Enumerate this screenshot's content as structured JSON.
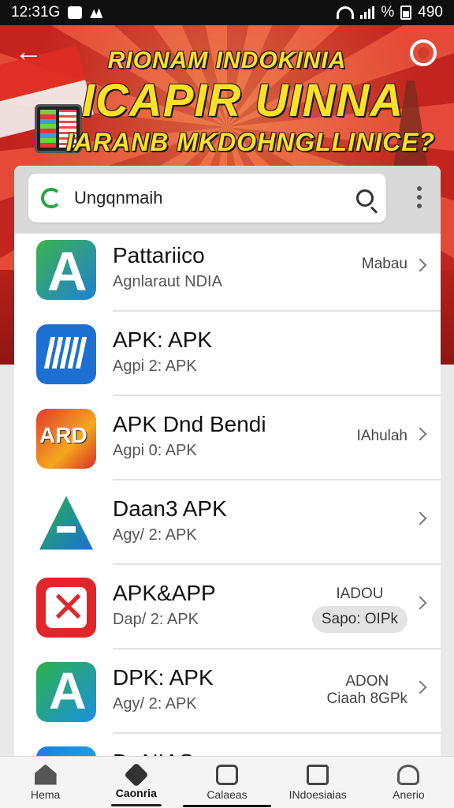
{
  "status_bar": {
    "time": "12:31G",
    "right_text": "%",
    "battery_text": "490"
  },
  "banner": {
    "line1": "RIONAM INDOKINIA",
    "line2": "ICAPIR UINNA",
    "line3": "IARANB MKDOHNGLLINICE?"
  },
  "search": {
    "value": "Ungqnmaih"
  },
  "apps": [
    {
      "title": "Pattariico",
      "subtitle": "Agnlaraut NDIA",
      "meta": "Mabau",
      "meta_pill": ""
    },
    {
      "title": "APK: APK",
      "subtitle": "Agpi 2: APK",
      "meta": "",
      "meta_pill": ""
    },
    {
      "title": "APK Dnd Bendi",
      "subtitle": "Agpi 0: APK",
      "meta": "IAhulah",
      "meta_pill": ""
    },
    {
      "title": "Daan3 APK",
      "subtitle": "Agy/ 2: APK",
      "meta": "",
      "meta_pill": ""
    },
    {
      "title": "APK&APP",
      "subtitle": "Dap/ 2: APK",
      "meta": "IADOU",
      "meta_pill": "Sapo: OIPk"
    },
    {
      "title": "DPK: APK",
      "subtitle": "Agy/ 2: APK",
      "meta": "ADON",
      "meta_pill": "Ciaah 8GPk"
    },
    {
      "title": "Dr NIAS",
      "subtitle": "",
      "meta": "",
      "meta_pill": ""
    }
  ],
  "nav": [
    {
      "label": "Hema",
      "icon": "home-icon"
    },
    {
      "label": "Caonria",
      "icon": "category-icon"
    },
    {
      "label": "Calaeas",
      "icon": "apps-icon"
    },
    {
      "label": "INdoesiaias",
      "icon": "download-icon"
    },
    {
      "label": "Anerio",
      "icon": "account-icon"
    }
  ]
}
